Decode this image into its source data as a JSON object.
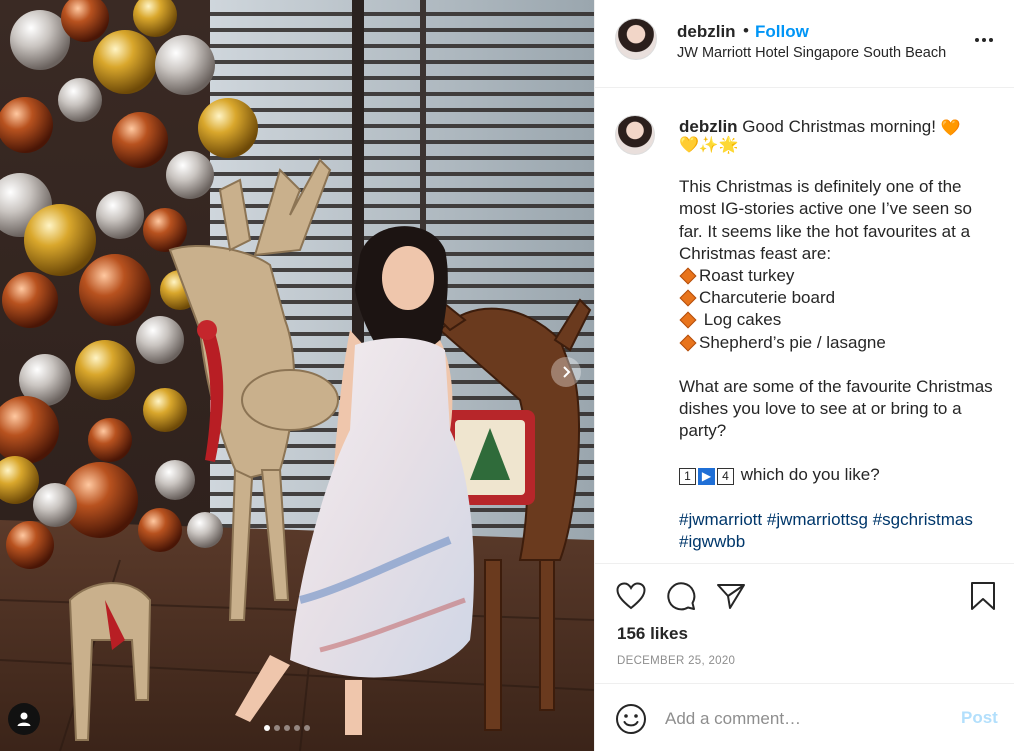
{
  "post": {
    "photo": {
      "carousel_count": 5,
      "carousel_active_index": 0
    },
    "header": {
      "username": "debzlin",
      "separator": "•",
      "follow_label": "Follow",
      "location": "JW Marriott Hotel Singapore South Beach",
      "more_icon": "more-horizontal-icon"
    },
    "caption": {
      "username": "debzlin",
      "line1": "Good Christmas morning!",
      "emojis_line1": "🧡",
      "emojis_line2": "💛✨🌟",
      "para1": "This Christmas is definitely one of the most IG-stories active one I’ve seen so far. It seems like the hot favourites at a Christmas feast are:",
      "items": [
        "Roast turkey",
        "Charcuterie board",
        " Log cakes",
        "Shepherd’s pie / lasagne"
      ],
      "para2": "What are some of the favourite Christmas dishes you love to see at or bring to a party?",
      "keycap_1": "1",
      "keycap_play": "▶",
      "keycap_4": "4",
      "question": "which do you like?",
      "hashtags": [
        "#jwmarriott",
        "#jwmarriottsg",
        "#sgchristmas",
        "#igwwbb"
      ]
    },
    "actions": {
      "like_icon": "heart-icon",
      "comment_icon": "comment-icon",
      "share_icon": "paper-plane-icon",
      "save_icon": "bookmark-icon"
    },
    "likes": "156 likes",
    "date": "DECEMBER 25, 2020",
    "comment": {
      "placeholder": "Add a comment…",
      "post_label": "Post"
    }
  },
  "colors": {
    "follow": "#0095f6",
    "hashtag": "#00376b",
    "post_disabled": "#b2dffc",
    "meta_grey": "#8e8e8e"
  }
}
